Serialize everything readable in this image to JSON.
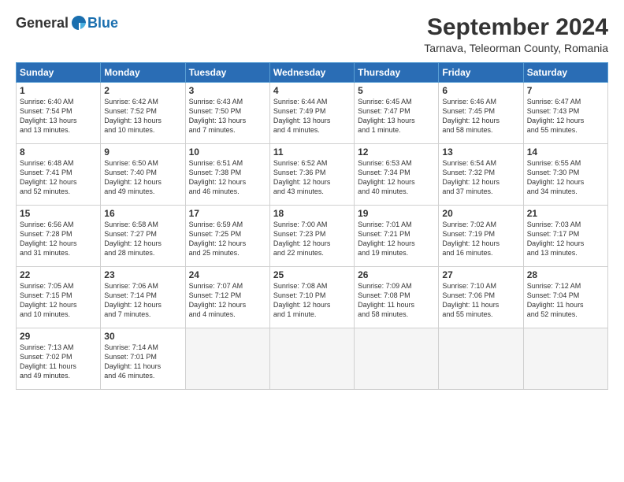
{
  "logo": {
    "general": "General",
    "blue": "Blue"
  },
  "title": "September 2024",
  "location": "Tarnava, Teleorman County, Romania",
  "days_header": [
    "Sunday",
    "Monday",
    "Tuesday",
    "Wednesday",
    "Thursday",
    "Friday",
    "Saturday"
  ],
  "weeks": [
    [
      {
        "day": "1",
        "info": "Sunrise: 6:40 AM\nSunset: 7:54 PM\nDaylight: 13 hours\nand 13 minutes."
      },
      {
        "day": "2",
        "info": "Sunrise: 6:42 AM\nSunset: 7:52 PM\nDaylight: 13 hours\nand 10 minutes."
      },
      {
        "day": "3",
        "info": "Sunrise: 6:43 AM\nSunset: 7:50 PM\nDaylight: 13 hours\nand 7 minutes."
      },
      {
        "day": "4",
        "info": "Sunrise: 6:44 AM\nSunset: 7:49 PM\nDaylight: 13 hours\nand 4 minutes."
      },
      {
        "day": "5",
        "info": "Sunrise: 6:45 AM\nSunset: 7:47 PM\nDaylight: 13 hours\nand 1 minute."
      },
      {
        "day": "6",
        "info": "Sunrise: 6:46 AM\nSunset: 7:45 PM\nDaylight: 12 hours\nand 58 minutes."
      },
      {
        "day": "7",
        "info": "Sunrise: 6:47 AM\nSunset: 7:43 PM\nDaylight: 12 hours\nand 55 minutes."
      }
    ],
    [
      {
        "day": "8",
        "info": "Sunrise: 6:48 AM\nSunset: 7:41 PM\nDaylight: 12 hours\nand 52 minutes."
      },
      {
        "day": "9",
        "info": "Sunrise: 6:50 AM\nSunset: 7:40 PM\nDaylight: 12 hours\nand 49 minutes."
      },
      {
        "day": "10",
        "info": "Sunrise: 6:51 AM\nSunset: 7:38 PM\nDaylight: 12 hours\nand 46 minutes."
      },
      {
        "day": "11",
        "info": "Sunrise: 6:52 AM\nSunset: 7:36 PM\nDaylight: 12 hours\nand 43 minutes."
      },
      {
        "day": "12",
        "info": "Sunrise: 6:53 AM\nSunset: 7:34 PM\nDaylight: 12 hours\nand 40 minutes."
      },
      {
        "day": "13",
        "info": "Sunrise: 6:54 AM\nSunset: 7:32 PM\nDaylight: 12 hours\nand 37 minutes."
      },
      {
        "day": "14",
        "info": "Sunrise: 6:55 AM\nSunset: 7:30 PM\nDaylight: 12 hours\nand 34 minutes."
      }
    ],
    [
      {
        "day": "15",
        "info": "Sunrise: 6:56 AM\nSunset: 7:28 PM\nDaylight: 12 hours\nand 31 minutes."
      },
      {
        "day": "16",
        "info": "Sunrise: 6:58 AM\nSunset: 7:27 PM\nDaylight: 12 hours\nand 28 minutes."
      },
      {
        "day": "17",
        "info": "Sunrise: 6:59 AM\nSunset: 7:25 PM\nDaylight: 12 hours\nand 25 minutes."
      },
      {
        "day": "18",
        "info": "Sunrise: 7:00 AM\nSunset: 7:23 PM\nDaylight: 12 hours\nand 22 minutes."
      },
      {
        "day": "19",
        "info": "Sunrise: 7:01 AM\nSunset: 7:21 PM\nDaylight: 12 hours\nand 19 minutes."
      },
      {
        "day": "20",
        "info": "Sunrise: 7:02 AM\nSunset: 7:19 PM\nDaylight: 12 hours\nand 16 minutes."
      },
      {
        "day": "21",
        "info": "Sunrise: 7:03 AM\nSunset: 7:17 PM\nDaylight: 12 hours\nand 13 minutes."
      }
    ],
    [
      {
        "day": "22",
        "info": "Sunrise: 7:05 AM\nSunset: 7:15 PM\nDaylight: 12 hours\nand 10 minutes."
      },
      {
        "day": "23",
        "info": "Sunrise: 7:06 AM\nSunset: 7:14 PM\nDaylight: 12 hours\nand 7 minutes."
      },
      {
        "day": "24",
        "info": "Sunrise: 7:07 AM\nSunset: 7:12 PM\nDaylight: 12 hours\nand 4 minutes."
      },
      {
        "day": "25",
        "info": "Sunrise: 7:08 AM\nSunset: 7:10 PM\nDaylight: 12 hours\nand 1 minute."
      },
      {
        "day": "26",
        "info": "Sunrise: 7:09 AM\nSunset: 7:08 PM\nDaylight: 11 hours\nand 58 minutes."
      },
      {
        "day": "27",
        "info": "Sunrise: 7:10 AM\nSunset: 7:06 PM\nDaylight: 11 hours\nand 55 minutes."
      },
      {
        "day": "28",
        "info": "Sunrise: 7:12 AM\nSunset: 7:04 PM\nDaylight: 11 hours\nand 52 minutes."
      }
    ],
    [
      {
        "day": "29",
        "info": "Sunrise: 7:13 AM\nSunset: 7:02 PM\nDaylight: 11 hours\nand 49 minutes."
      },
      {
        "day": "30",
        "info": "Sunrise: 7:14 AM\nSunset: 7:01 PM\nDaylight: 11 hours\nand 46 minutes."
      },
      {
        "day": "",
        "info": ""
      },
      {
        "day": "",
        "info": ""
      },
      {
        "day": "",
        "info": ""
      },
      {
        "day": "",
        "info": ""
      },
      {
        "day": "",
        "info": ""
      }
    ]
  ]
}
